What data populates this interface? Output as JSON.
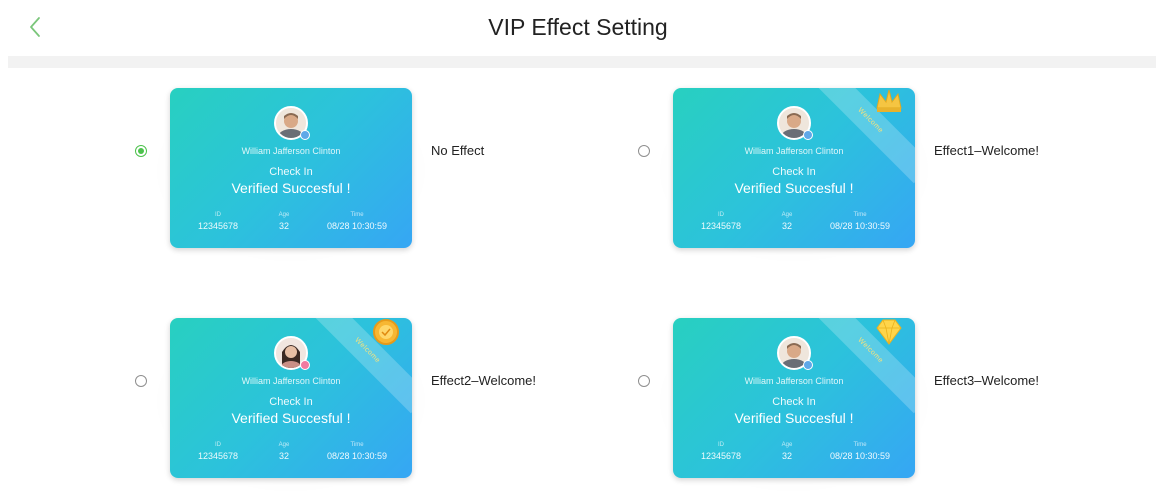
{
  "header": {
    "title": "VIP Effect Setting",
    "back_icon": "chevron-left-icon"
  },
  "colors": {
    "accent": "#4cc24c",
    "card_start": "#28d0c0",
    "card_end": "#36a6f4",
    "ribbon_text": "#f7e27a"
  },
  "card": {
    "name": "William Jafferson Clinton",
    "status": "Check In",
    "message": "Verified Succesful !",
    "id_label": "ID",
    "id_value": "12345678",
    "age_label": "Age",
    "age_value": "32",
    "time_label": "Time",
    "time_value": "08/28  10:30:59",
    "ribbon_text": "Welcome"
  },
  "options": [
    {
      "label": "No Effect",
      "selected": true,
      "decoration": "none"
    },
    {
      "label": "Effect1–Welcome!",
      "selected": false,
      "decoration": "crown-icon"
    },
    {
      "label": "Effect2–Welcome!",
      "selected": false,
      "decoration": "medal-icon"
    },
    {
      "label": "Effect3–Welcome!",
      "selected": false,
      "decoration": "diamond-icon"
    }
  ]
}
